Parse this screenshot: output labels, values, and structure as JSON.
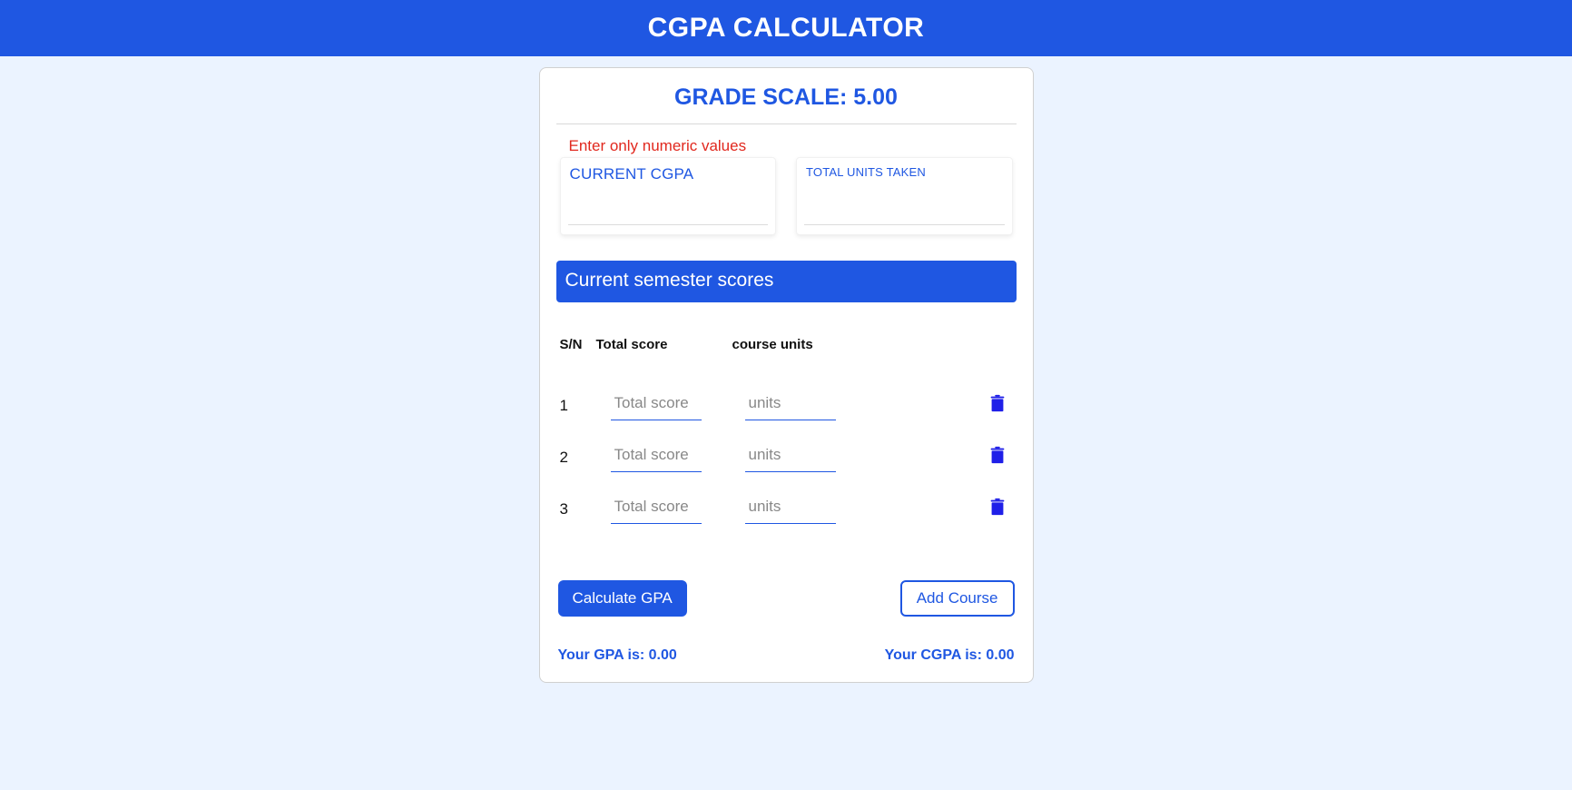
{
  "header": {
    "title": "CGPA CALCULATOR"
  },
  "scale": {
    "label_prefix": "GRADE SCALE: ",
    "value": "5.00"
  },
  "warning": "Enter only numeric values",
  "cgpa_input": {
    "label": "CURRENT CGPA",
    "value": ""
  },
  "units_input": {
    "label": "TOTAL UNITS TAKEN",
    "value": ""
  },
  "section_banner": "Current semester scores",
  "columns": {
    "sn": "S/N",
    "score": "Total score",
    "units": "course units"
  },
  "placeholders": {
    "score": "Total score",
    "units": "units"
  },
  "rows": [
    {
      "sn": "1",
      "score": "",
      "units": ""
    },
    {
      "sn": "2",
      "score": "",
      "units": ""
    },
    {
      "sn": "3",
      "score": "",
      "units": ""
    }
  ],
  "buttons": {
    "calculate": "Calculate GPA",
    "add": "Add Course"
  },
  "results": {
    "gpa_label": "Your GPA is: ",
    "gpa_value": "0.00",
    "cgpa_label": "Your CGPA is: ",
    "cgpa_value": "0.00"
  },
  "colors": {
    "primary": "#1f57e2",
    "page_bg": "#ebf3ff",
    "warning": "#e1281e"
  }
}
